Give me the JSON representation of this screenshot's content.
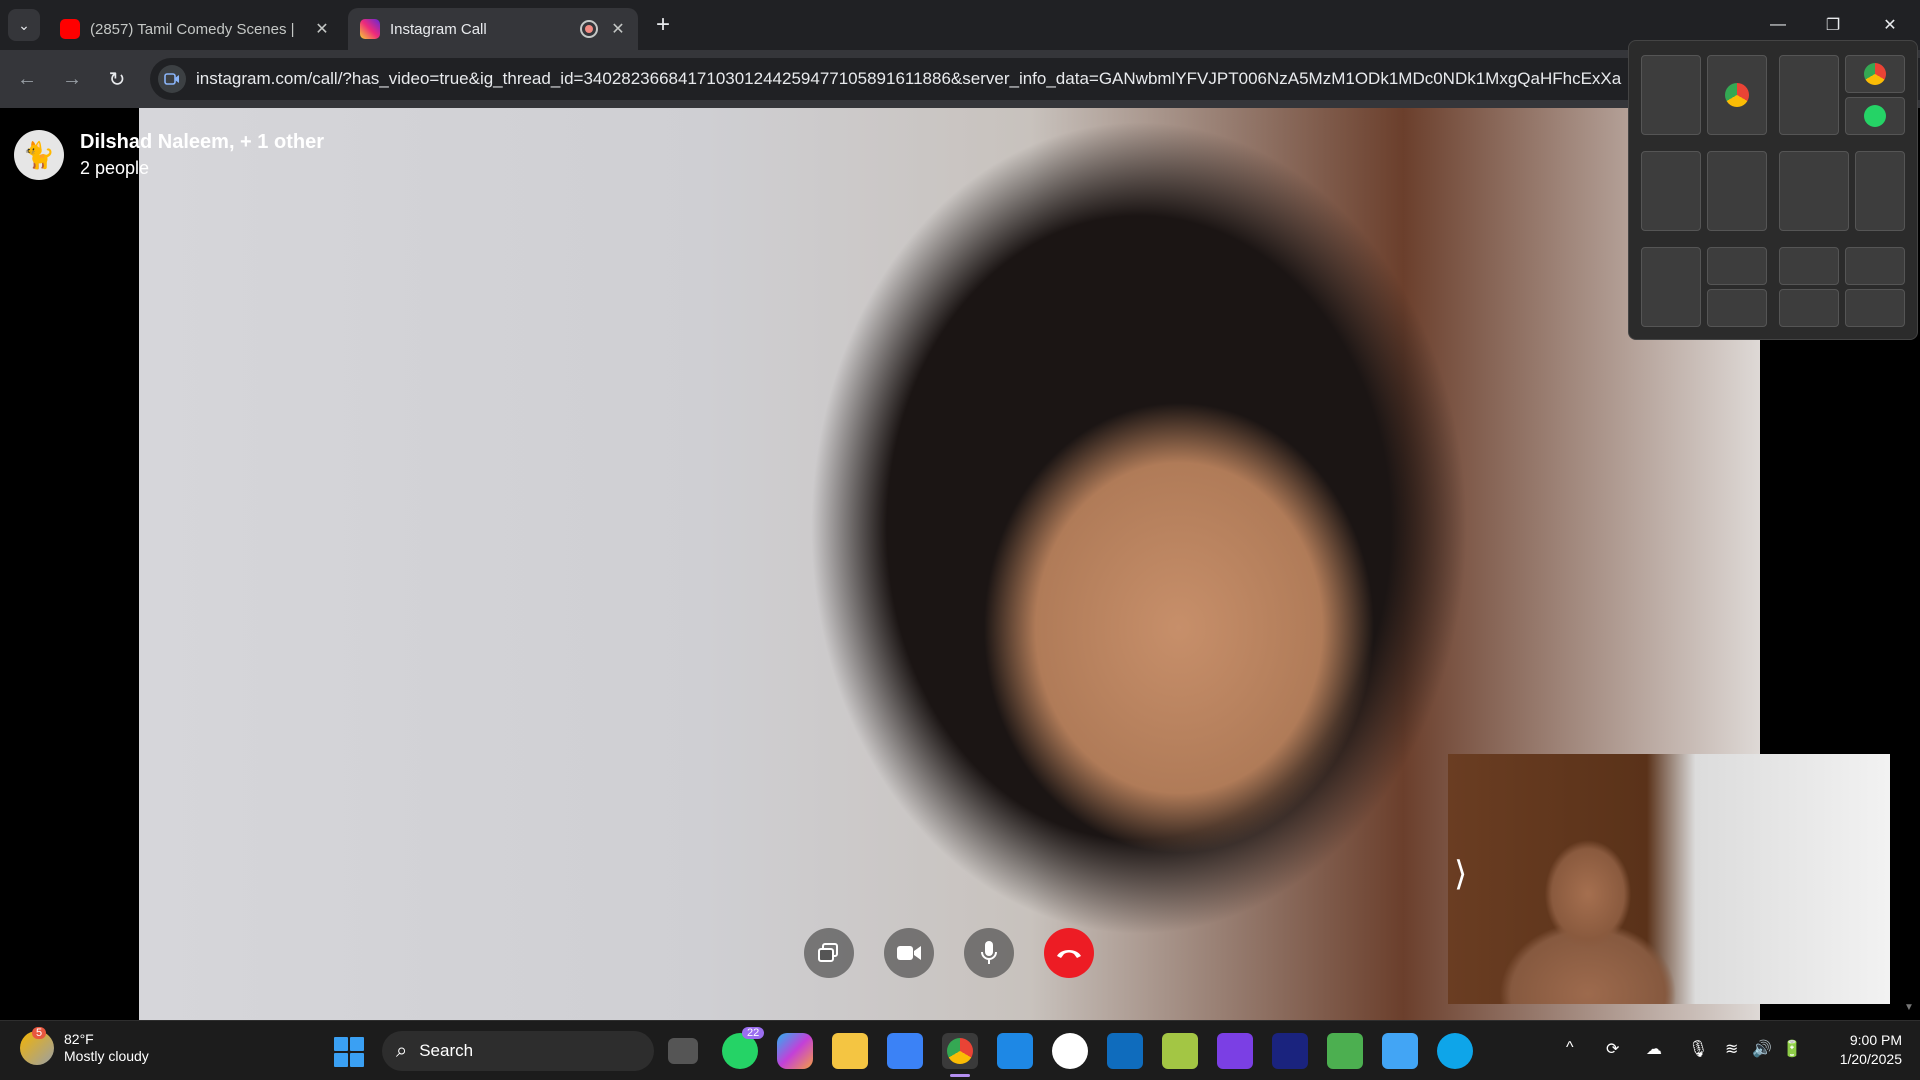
{
  "browser": {
    "tabs": [
      {
        "title": "(2857) Tamil Comedy Scenes | ",
        "favicon_color": "#ff0000",
        "active": false
      },
      {
        "title": "Instagram Call",
        "favicon_color": "#e1306c",
        "active": true
      }
    ],
    "new_tab_label": "+",
    "window_controls": {
      "minimize": "—",
      "restore": "❐",
      "close": "✕"
    },
    "nav": {
      "back": "←",
      "forward": "→",
      "reload": "↻"
    },
    "address": "instagram.com/call/?has_video=true&ig_thread_id=340282366841710301244259477105891611886&server_info_data=GANwbmlYFVJPT006NzA5MzM1ODk1MDc0NDk1MxgQaHFhcExXa"
  },
  "call": {
    "participant_name": "Dilshad Naleem, + 1 other",
    "participant_count": "2 people",
    "controls": [
      {
        "name": "screen-share",
        "glyph": "⧉"
      },
      {
        "name": "video",
        "glyph": "■"
      },
      {
        "name": "mic",
        "glyph": "🎙"
      },
      {
        "name": "end-call",
        "glyph": "☎"
      }
    ],
    "self_view_chevron": "⟩"
  },
  "snap_layouts": {
    "title": ""
  },
  "taskbar": {
    "weather": {
      "badge": "5",
      "temp": "82°F",
      "condition": "Mostly cloudy"
    },
    "search_placeholder": "Search",
    "whatsapp_badge": "22",
    "clock": {
      "time": "9:00 PM",
      "date": "1/20/2025"
    },
    "tray": [
      "^",
      "⟳",
      "☁",
      "🎙",
      "≋",
      "🔊",
      "🔋"
    ]
  }
}
